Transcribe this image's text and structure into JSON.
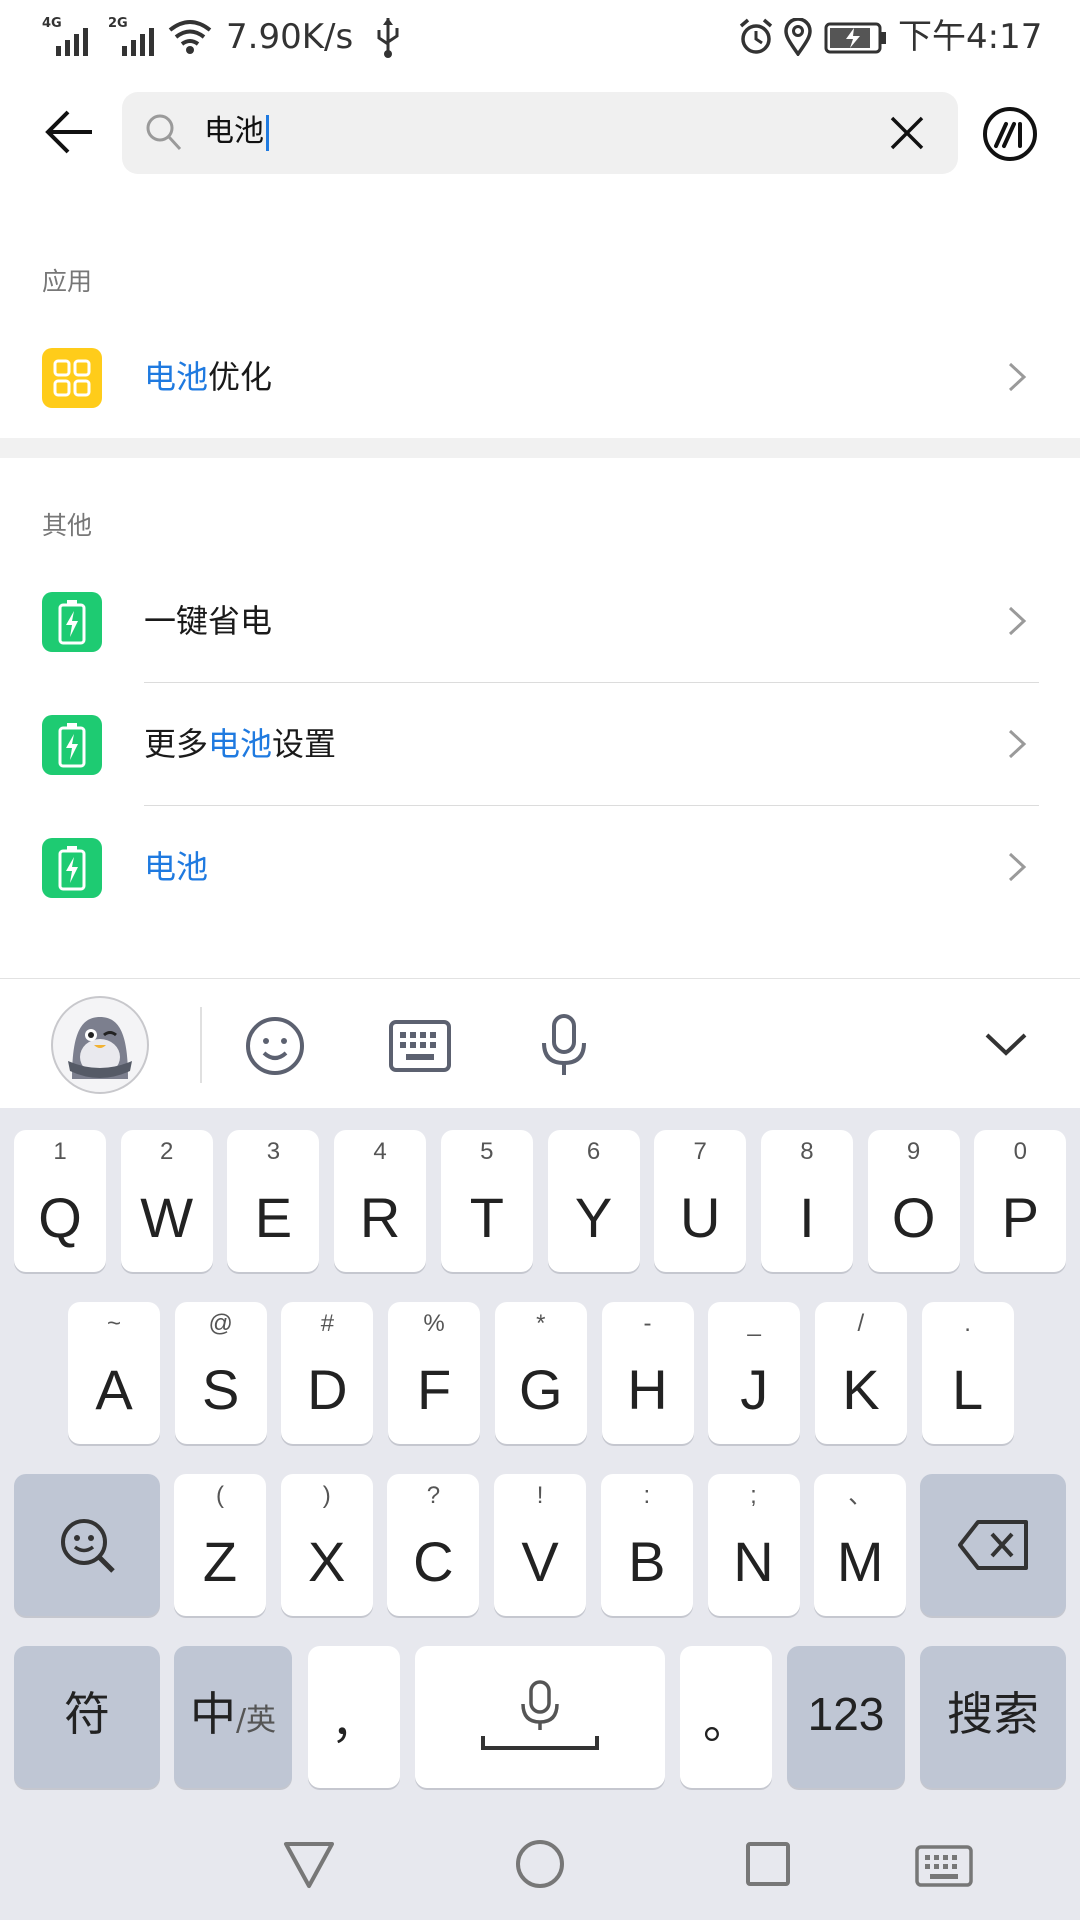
{
  "status_bar": {
    "net1": "4G",
    "net2": "2G",
    "speed": "7.90K/s",
    "time": "下午4:17"
  },
  "search": {
    "query": "电池",
    "back_icon": "back-arrow-icon",
    "clear_icon": "close-icon",
    "voice_assistant_icon": "voice-assistant-icon"
  },
  "sections": {
    "apps_label": "应用",
    "others_label": "其他"
  },
  "results": {
    "app_item": {
      "hl": "电池",
      "rest": "优化"
    },
    "other_1": {
      "text": "一键省电"
    },
    "other_2": {
      "pre": "更多",
      "hl": "电池",
      "post": "设置"
    },
    "other_3": {
      "hl": "电池"
    }
  },
  "keyboard": {
    "row1": [
      {
        "main": "Q",
        "sub": "1"
      },
      {
        "main": "W",
        "sub": "2"
      },
      {
        "main": "E",
        "sub": "3"
      },
      {
        "main": "R",
        "sub": "4"
      },
      {
        "main": "T",
        "sub": "5"
      },
      {
        "main": "Y",
        "sub": "6"
      },
      {
        "main": "U",
        "sub": "7"
      },
      {
        "main": "I",
        "sub": "8"
      },
      {
        "main": "O",
        "sub": "9"
      },
      {
        "main": "P",
        "sub": "0"
      }
    ],
    "row2": [
      {
        "main": "A",
        "sub": "~"
      },
      {
        "main": "S",
        "sub": "@"
      },
      {
        "main": "D",
        "sub": "#"
      },
      {
        "main": "F",
        "sub": "%"
      },
      {
        "main": "G",
        "sub": "*"
      },
      {
        "main": "H",
        "sub": "-"
      },
      {
        "main": "J",
        "sub": "_"
      },
      {
        "main": "K",
        "sub": "/"
      },
      {
        "main": "L",
        "sub": "."
      }
    ],
    "row3": [
      {
        "main": "Z",
        "sub": "("
      },
      {
        "main": "X",
        "sub": ")"
      },
      {
        "main": "C",
        "sub": "?"
      },
      {
        "main": "V",
        "sub": "!"
      },
      {
        "main": "B",
        "sub": ":"
      },
      {
        "main": "N",
        "sub": ";"
      },
      {
        "main": "M",
        "sub": "、"
      }
    ],
    "symbols_key": "符",
    "lang_key_main": "中",
    "lang_key_sub": "/英",
    "comma_key": "，",
    "period_key": "。",
    "num_key": "123",
    "search_key": "搜索"
  },
  "colors": {
    "accent": "#1f7ae0",
    "app_icon_yellow": "#ffcc1a",
    "battery_green": "#1ecb72"
  }
}
